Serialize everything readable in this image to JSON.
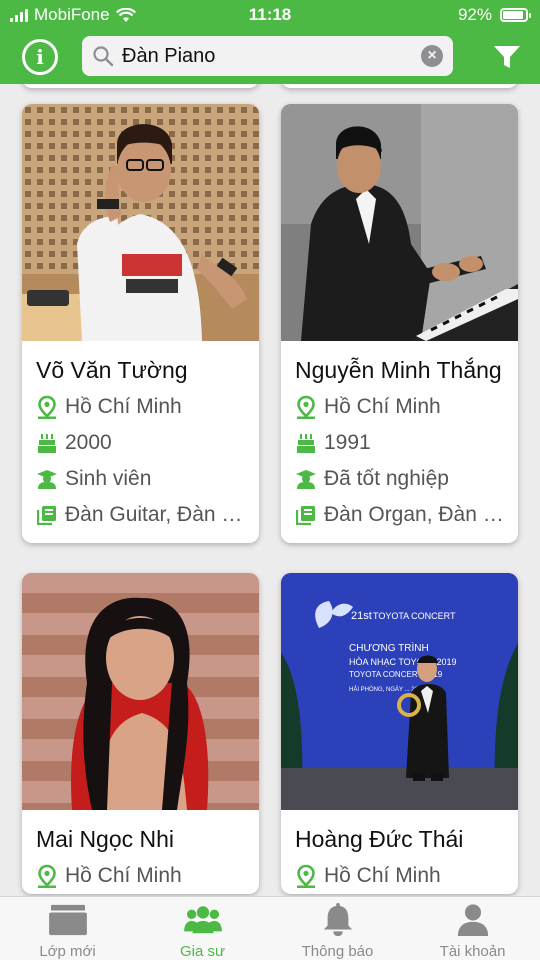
{
  "status_bar": {
    "carrier": "MobiFone",
    "time": "11:18",
    "battery": "92%",
    "battery_level": 0.92
  },
  "search": {
    "value": "Đàn Piano",
    "clear": "×"
  },
  "navbar": {
    "info": "i"
  },
  "tutors": [
    {
      "name": "Võ Văn Tường",
      "location": "Hồ Chí Minh",
      "birth_year": "2000",
      "status": "Sinh viên",
      "subjects": "Đàn Guitar, Đàn Piano"
    },
    {
      "name": "Nguyễn Minh Thắng",
      "location": "Hồ Chí Minh",
      "birth_year": "1991",
      "status": "Đã tốt nghiệp",
      "subjects": "Đàn Organ, Đàn Piano"
    },
    {
      "name": "Mai Ngọc Nhi",
      "location": "Hồ Chí Minh"
    },
    {
      "name": "Hoàng Đức Thái",
      "location": "Hồ Chí Minh"
    }
  ],
  "poster": {
    "edition": "21st",
    "brand": "TOYOTA CONCERT",
    "line1": "CHƯƠNG TRÌNH",
    "line2": "HÒA NHẠC TOYOTA 2019",
    "line3": "TOYOTA CONCERT 2019",
    "line4": "HẢI PHÒNG, NGÀY ... 2019"
  },
  "tabs": [
    {
      "label": "Lớp mới",
      "icon": "classes-icon",
      "active": false
    },
    {
      "label": "Gia sư",
      "icon": "tutors-icon",
      "active": true
    },
    {
      "label": "Thông báo",
      "icon": "bell-icon",
      "active": false
    },
    {
      "label": "Tài khoản",
      "icon": "account-icon",
      "active": false
    }
  ],
  "colors": {
    "brand_green": "#4cb944",
    "icon_green": "#4cb944",
    "tab_inactive": "#8a8a8a"
  }
}
